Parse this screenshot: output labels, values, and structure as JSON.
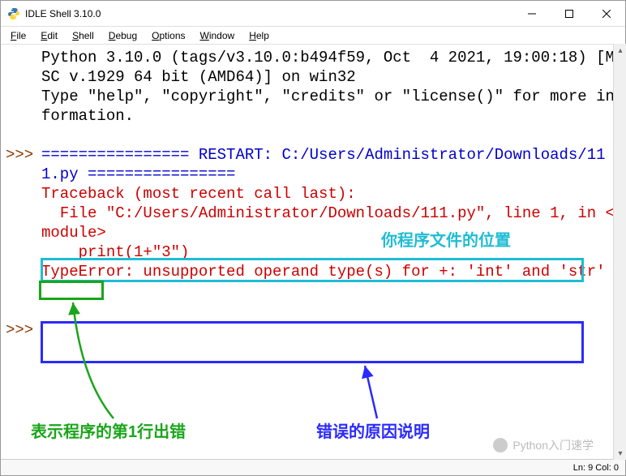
{
  "window": {
    "title": "IDLE Shell 3.10.0"
  },
  "menubar": {
    "items": [
      {
        "label": "File"
      },
      {
        "label": "Edit"
      },
      {
        "label": "Shell"
      },
      {
        "label": "Debug"
      },
      {
        "label": "Options"
      },
      {
        "label": "Window"
      },
      {
        "label": "Help"
      }
    ]
  },
  "console": {
    "prompt1": ">>>",
    "prompt2": ">>>",
    "banner_line1": "Python 3.10.0 (tags/v3.10.0:b494f59, Oct  4 2021, 19:00:18) [MSC v.1929 64 bit (AMD64)] on win32",
    "banner_line2": "Type \"help\", \"copyright\", \"credits\" or \"license()\" for more information.",
    "restart_line": "================ RESTART: C:/Users/Administrator/Downloads/111.py ================",
    "tb_header": "Traceback (most recent call last):",
    "tb_file": "  File \"C:/Users/Administrator/Downloads/111.py\", line 1, in <module>",
    "tb_code": "    print(1+\"3\")",
    "tb_err": "TypeError: unsupported operand type(s) for +: 'int' and 'str'"
  },
  "annotations": {
    "file_location_label": "你程序文件的位置",
    "line_error_label": "表示程序的第1行出错",
    "error_reason_label": "错误的原因说明",
    "box_cyan_color": "#1fbcd3",
    "box_green_color": "#1aa51a",
    "box_blue_color": "#2a2aff"
  },
  "statusbar": {
    "text": "Ln: 9   Col: 0"
  },
  "watermark": {
    "text": "Python入门速学"
  }
}
